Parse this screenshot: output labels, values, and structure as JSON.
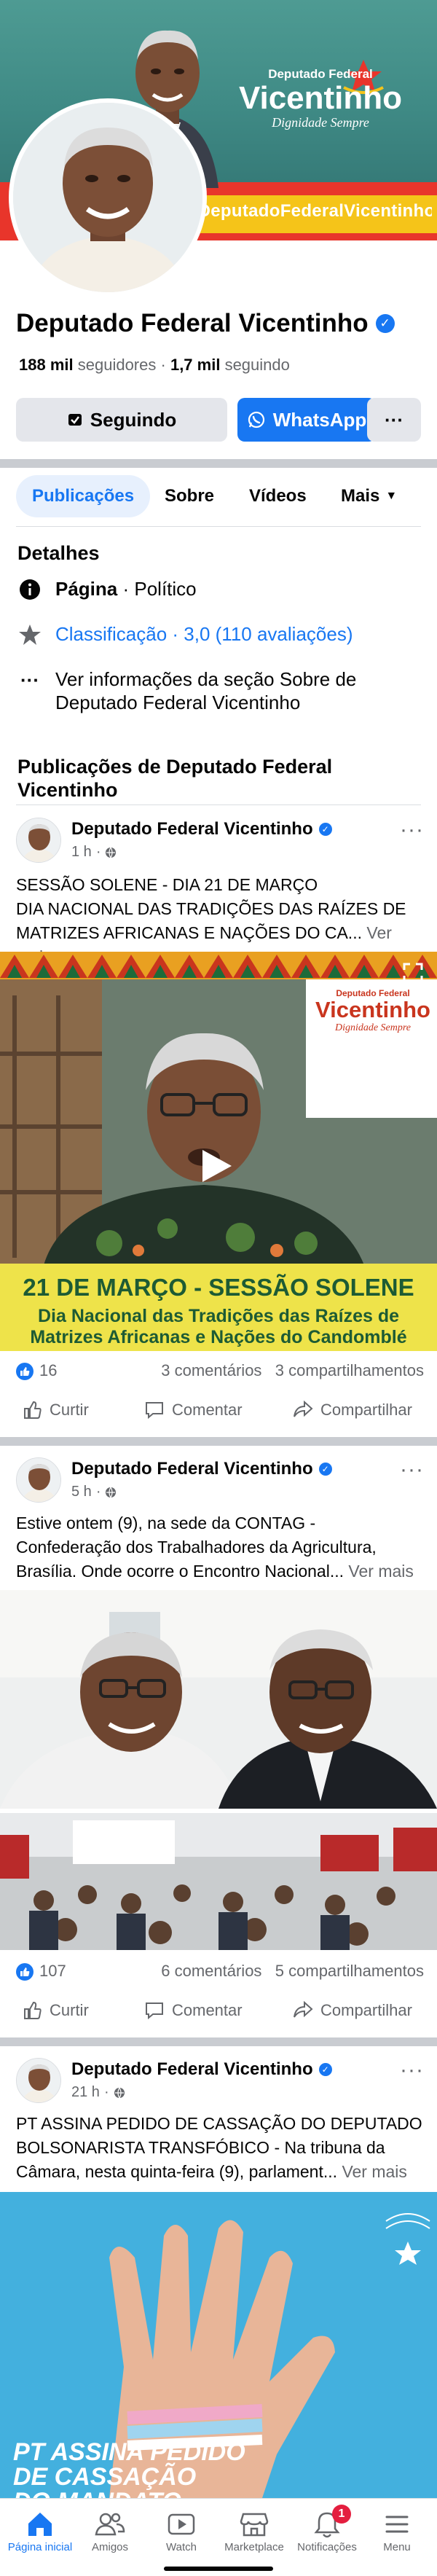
{
  "cover": {
    "brand_line1": "Deputado Federal",
    "brand_line2": "Vicentinho",
    "brand_line3": "Dignidade Sempre",
    "hashtag": "#DeputadoFederalVicentinho"
  },
  "profile": {
    "name": "Deputado Federal Vicentinho",
    "followers_count": "188 mil",
    "followers_label": "seguidores",
    "following_count": "1,7 mil",
    "following_label": "seguindo",
    "follow_button": "Seguindo",
    "whatsapp_button": "WhatsApp"
  },
  "tabs": [
    {
      "label": "Publicações"
    },
    {
      "label": "Sobre"
    },
    {
      "label": "Vídeos"
    },
    {
      "label": "Mais"
    }
  ],
  "details": {
    "title": "Detalhes",
    "category_prefix": "Página",
    "category": "Político",
    "rating": "Classificação · 3,0 (110 avaliações)",
    "about_link": "Ver informações da seção Sobre de Deputado Federal Vicentinho"
  },
  "posts_title": "Publicações de Deputado Federal Vicentinho",
  "posts": [
    {
      "author": "Deputado Federal Vicentinho",
      "time": "1 h",
      "text_l1": "SESSÃO SOLENE - DIA 21 DE MARÇO",
      "text_l2": "DIA NACIONAL DAS TRADIÇÕES DAS RAÍZES DE",
      "text_l3": "MATRIZES AFRICANAS E NAÇÕES DO CA...",
      "see_more": "Ver mais",
      "media": {
        "brand_line1": "Deputado Federal",
        "brand_line2": "Vicentinho",
        "brand_line3": "Dignidade Sempre",
        "banner_title": "21 DE MARÇO - SESSÃO SOLENE",
        "banner_sub1": "Dia Nacional das Tradições das Raízes de",
        "banner_sub2": "Matrizes Africanas e Nações do Candomblé"
      },
      "likes": "16",
      "comments": "3 comentários",
      "shares": "3 compartilhamentos"
    },
    {
      "author": "Deputado Federal Vicentinho",
      "time": "5 h",
      "text_l1": "Estive ontem (9), na sede da CONTAG -",
      "text_l2": "Confederação dos Trabalhadores da Agricultura,",
      "text_l3": "Brasília. Onde ocorre o Encontro Nacional...",
      "see_more": "Ver mais",
      "likes": "107",
      "comments": "6 comentários",
      "shares": "5 compartilhamentos"
    },
    {
      "author": "Deputado Federal Vicentinho",
      "time": "21 h",
      "text_l1": "PT ASSINA PEDIDO DE CASSAÇÃO DO DEPUTADO",
      "text_l2": "BOLSONARISTA TRANSFÓBICO - Na tribuna da",
      "text_l3": "Câmara, nesta quinta-feira (9), parlament...",
      "see_more": "Ver mais",
      "media": {
        "overlay_l1": "PT ASSINA PEDIDO",
        "overlay_l2": "DE CASSAÇÃO",
        "overlay_l3": "DO MANDATO"
      }
    }
  ],
  "actions": {
    "like": "Curtir",
    "comment": "Comentar",
    "share": "Compartilhar"
  },
  "bottom_nav": [
    {
      "label": "Página inicial",
      "icon": "home-icon"
    },
    {
      "label": "Amigos",
      "icon": "friends-icon"
    },
    {
      "label": "Watch",
      "icon": "watch-icon"
    },
    {
      "label": "Marketplace",
      "icon": "marketplace-icon"
    },
    {
      "label": "Notificações",
      "icon": "bell-icon",
      "badge": "1"
    },
    {
      "label": "Menu",
      "icon": "menu-icon"
    }
  ],
  "colors": {
    "accent": "#1877f2",
    "cover_teal": "#4e9b93",
    "cover_red": "#e8352b",
    "cover_yellow": "#f5c419",
    "badge_red": "#e41e3f"
  }
}
